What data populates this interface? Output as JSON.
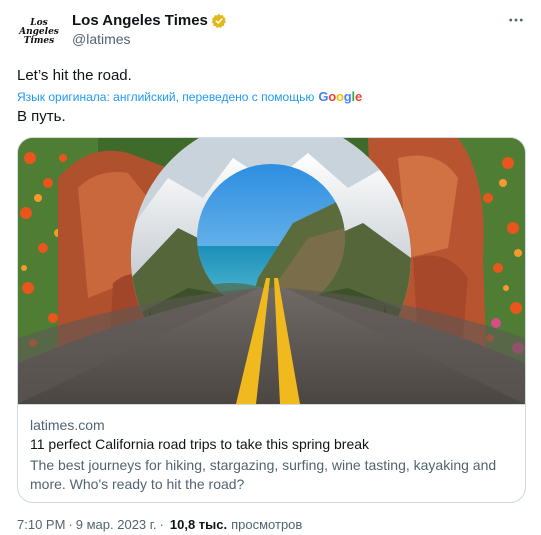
{
  "author": {
    "avatar_text": "Los\nAngeles\nTimes",
    "display_name": "Los Angeles Times",
    "handle": "@latimes",
    "verified_icon": "gold-verified-badge",
    "verified_color": "#e2b719"
  },
  "tweet": {
    "text": "Let’s hit the road.",
    "translation_label": "Язык оригинала: английский, переведено с помощью",
    "translation_provider": "Google",
    "translated_text": "В путь."
  },
  "card": {
    "image_icon": "california-road-collage-image",
    "domain": "latimes.com",
    "title": "11 perfect California road trips to take this spring break",
    "description": "The best journeys for hiking, stargazing, surfing, wine tasting, kayaking and more. Who's ready to hit the road?"
  },
  "footer": {
    "time": "7:10 PM",
    "separator": "·",
    "date": "9 мар. 2023 г.",
    "views_count": "10,8 тыс.",
    "views_label": "просмотров"
  },
  "colors": {
    "link": "#1d9bf0",
    "secondary_text": "#536471",
    "primary_text": "#0f1419",
    "border": "#cfd9de"
  }
}
